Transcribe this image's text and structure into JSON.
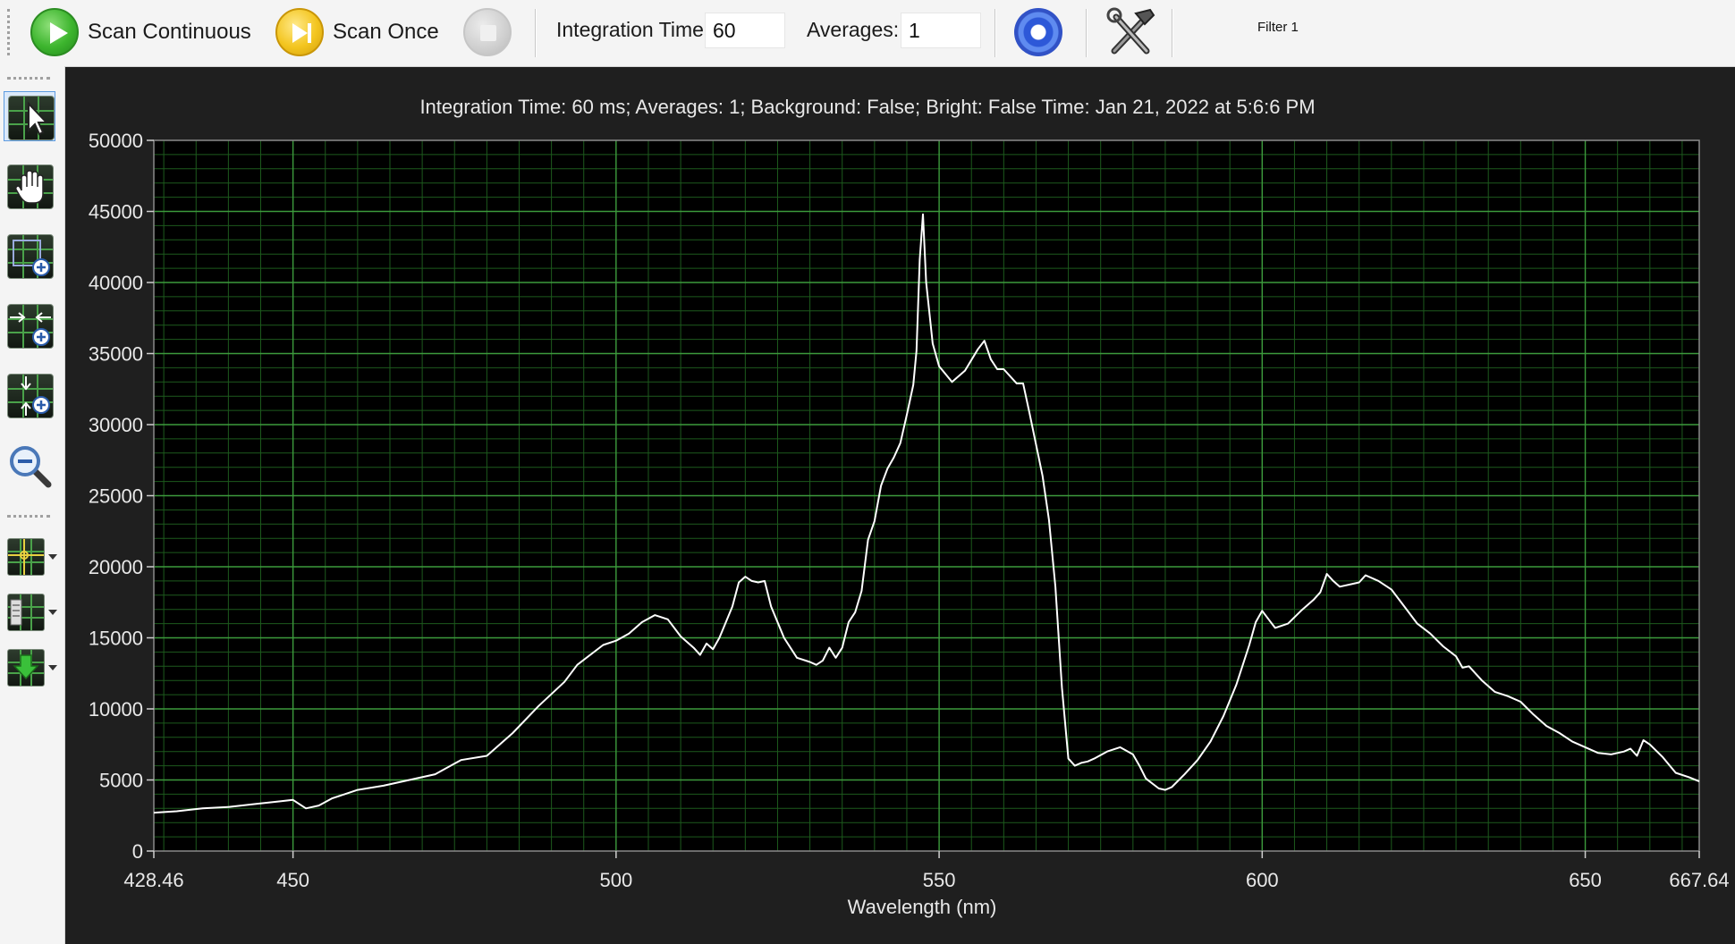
{
  "toolbar": {
    "scan_continuous_label": "Scan Continuous",
    "scan_once_label": "Scan Once",
    "integration_time_label": "Integration Time:",
    "integration_time_value": "60",
    "averages_label": "Averages:",
    "averages_value": "1",
    "filter_label": "Filter 1",
    "icons": [
      "play-icon",
      "scan-once-icon",
      "stop-icon",
      "target-icon",
      "tools-icon"
    ]
  },
  "sidebar": {
    "icons": [
      "pointer-icon",
      "hand-pan-icon",
      "zoom-box-icon",
      "zoom-horizontal-icon",
      "zoom-vertical-icon",
      "zoom-out-icon",
      "cursor-icon",
      "legend-icon",
      "download-icon"
    ]
  },
  "chart_data": {
    "type": "line",
    "title": "Integration Time: 60 ms; Averages: 1; Background: False; Bright: False Time: Jan 21, 2022 at 5:6:6 PM",
    "xlabel": "Wavelength (nm)",
    "ylabel": "",
    "xlim": [
      428.46,
      667.64
    ],
    "ylim": [
      0,
      50000
    ],
    "x_ticks": [
      "428.46",
      "450",
      "500",
      "550",
      "600",
      "650",
      "667.64"
    ],
    "y_ticks": [
      "0",
      "5000",
      "10000",
      "15000",
      "20000",
      "25000",
      "30000",
      "35000",
      "40000",
      "45000",
      "50000"
    ],
    "grid": true,
    "series": [
      {
        "color": "#ffffff",
        "x": [
          428.46,
          432,
          436,
          440,
          444,
          448,
          450,
          452,
          454,
          456,
          458,
          460,
          464,
          468,
          472,
          476,
          480,
          484,
          488,
          492,
          494,
          498,
          500,
          502,
          504,
          506,
          508,
          510,
          512,
          513,
          514,
          515,
          516,
          518,
          519,
          520,
          521,
          522,
          523,
          524,
          526,
          528,
          530,
          531,
          532,
          533,
          534,
          535,
          536,
          537,
          538,
          539,
          540,
          541,
          542,
          543,
          544,
          545,
          546,
          546.5,
          547,
          547.5,
          548,
          549,
          550,
          552,
          554,
          556,
          557,
          558,
          559,
          560,
          562,
          563,
          564,
          566,
          567,
          568,
          569,
          570,
          571,
          572,
          573,
          574,
          576,
          578,
          580,
          581,
          582,
          584,
          585,
          586,
          588,
          590,
          592,
          594,
          596,
          598,
          599,
          600,
          601,
          602,
          604,
          606,
          608,
          609,
          610,
          611,
          612,
          614,
          615,
          616,
          618,
          620,
          622,
          624,
          626,
          628,
          630,
          631,
          632,
          634,
          636,
          638,
          640,
          642,
          644,
          646,
          648,
          650,
          652,
          654,
          656,
          657,
          658,
          659,
          660,
          662,
          664,
          666,
          667.64
        ],
        "y": [
          2700,
          2800,
          3000,
          3100,
          3300,
          3500,
          3600,
          3000,
          3200,
          3700,
          4000,
          4300,
          4600,
          5000,
          5400,
          6400,
          6700,
          8300,
          10200,
          11900,
          13100,
          14500,
          14800,
          15300,
          16100,
          16600,
          16300,
          15100,
          14300,
          13800,
          14600,
          14200,
          15000,
          17200,
          18900,
          19300,
          19000,
          18900,
          19000,
          17200,
          15000,
          13600,
          13300,
          13100,
          13400,
          14300,
          13600,
          14300,
          16100,
          16800,
          18300,
          21900,
          23200,
          25700,
          26900,
          27700,
          28700,
          30700,
          32800,
          35200,
          41600,
          44800,
          40000,
          35700,
          34100,
          33000,
          33800,
          35300,
          35900,
          34600,
          33900,
          33900,
          32900,
          32900,
          30800,
          26400,
          23300,
          18600,
          11500,
          6500,
          6000,
          6200,
          6300,
          6500,
          7000,
          7300,
          6800,
          6000,
          5100,
          4400,
          4300,
          4500,
          5400,
          6400,
          7700,
          9500,
          11700,
          14500,
          16100,
          16900,
          16300,
          15700,
          16000,
          16900,
          17700,
          18200,
          19500,
          19000,
          18600,
          18800,
          18900,
          19400,
          19000,
          18400,
          17200,
          16000,
          15300,
          14400,
          13700,
          12900,
          13000,
          12000,
          11200,
          10900,
          10500,
          9600,
          8800,
          8300,
          7700,
          7300,
          6900,
          6800,
          7000,
          7200,
          6700,
          7800,
          7500,
          6600,
          5500,
          5200,
          4900
        ]
      }
    ]
  }
}
